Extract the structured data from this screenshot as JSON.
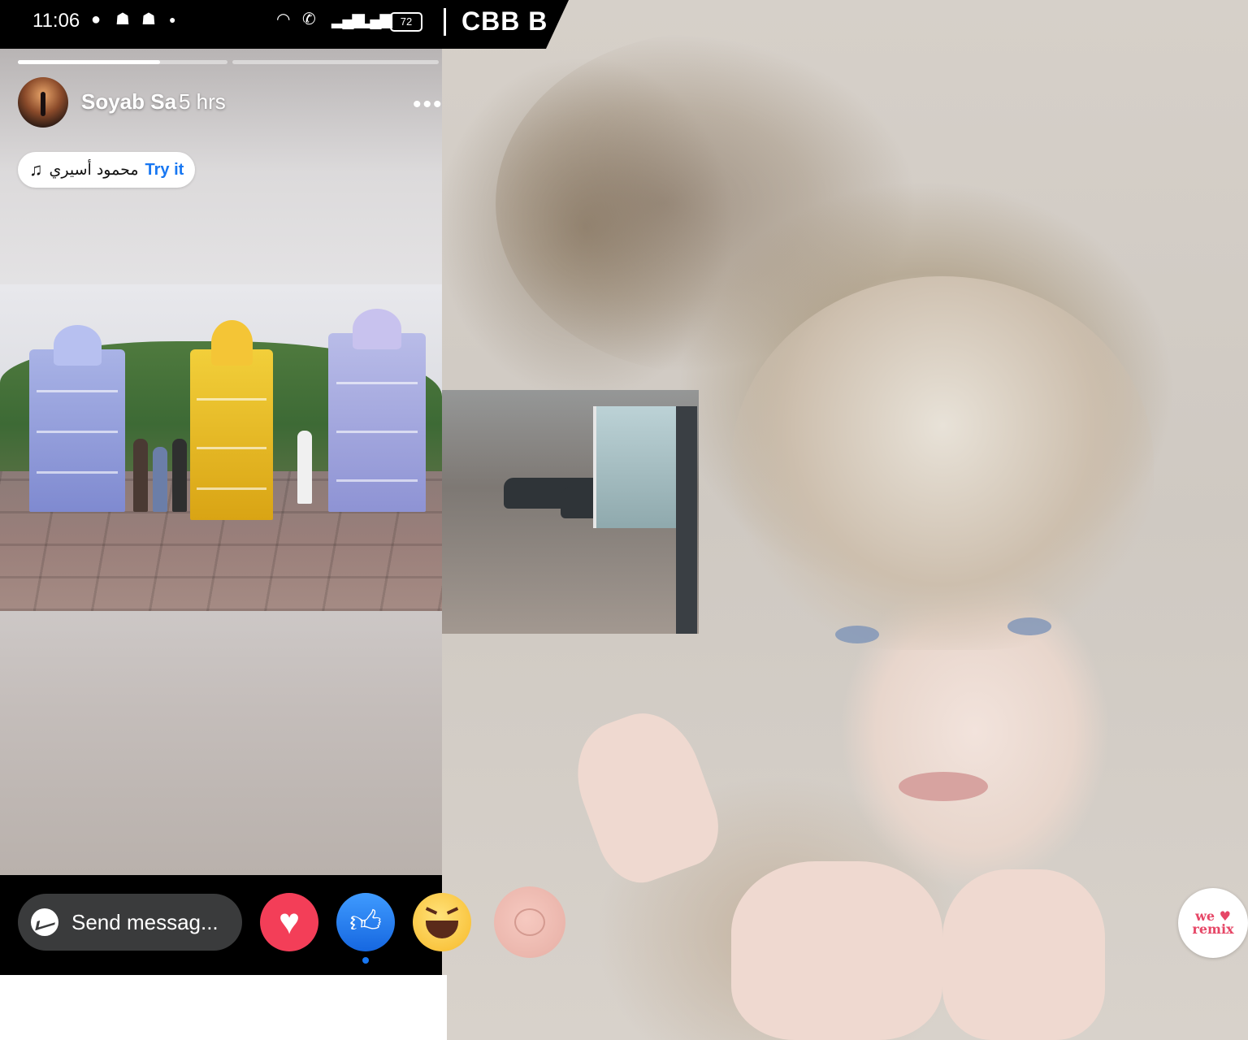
{
  "status_bar": {
    "time": "11:06",
    "notification_icons": [
      "messenger-icon",
      "snapchat-icon",
      "snapchat-icon",
      "dot-icon"
    ],
    "battery": "72",
    "carrier": "CBB B"
  },
  "story": {
    "progress_segments": 2,
    "progress_first_fraction": 0.68,
    "poster_name": "Soyab Sa",
    "post_time": "5 hrs",
    "more_options": "•••",
    "music": {
      "icon": "music-note-icon",
      "artist": "محمود أسيري",
      "try_label": "Try it"
    }
  },
  "reply_bar": {
    "send_label": "Send messag...",
    "reactions": [
      "love",
      "like",
      "haha",
      "custom"
    ],
    "selected_reaction": "like"
  },
  "watermark": {
    "line1": "we ♥",
    "line2": "remix"
  },
  "colors": {
    "accent": "#1877f2",
    "love": "#f33e58",
    "haha": "#f7b928",
    "reply_bar": "#000000"
  }
}
